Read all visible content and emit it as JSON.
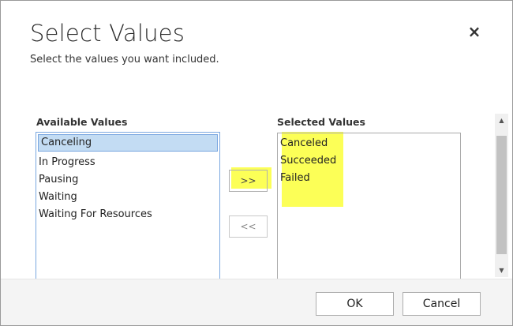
{
  "dialog": {
    "title": "Select Values",
    "subtitle": "Select the values you want included.",
    "close_icon": "×"
  },
  "available": {
    "label": "Available Values",
    "items": [
      "Canceling",
      "In Progress",
      "Pausing",
      "Waiting",
      "Waiting For Resources"
    ],
    "selected_item": "Canceling"
  },
  "selected": {
    "label": "Selected Values",
    "items": [
      "Canceled",
      "Succeeded",
      "Failed"
    ]
  },
  "move": {
    "add_label": ">>",
    "remove_label": "<<"
  },
  "scrollbar": {
    "up_icon": "▲",
    "down_icon": "▼"
  },
  "footer": {
    "ok_label": "OK",
    "cancel_label": "Cancel"
  },
  "colors": {
    "highlight": "#fbff3a",
    "selection": "#c3dcf3",
    "selection_border": "#7aa7e0"
  }
}
